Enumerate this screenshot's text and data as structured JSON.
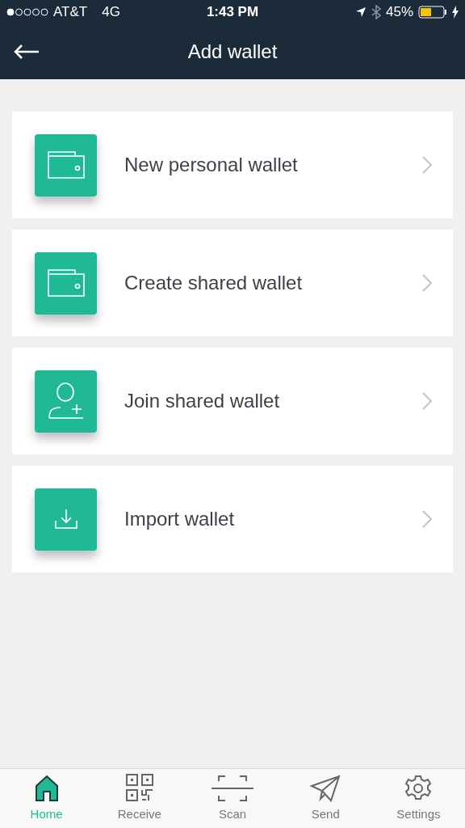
{
  "status_bar": {
    "carrier": "AT&T",
    "network": "4G",
    "time": "1:43 PM",
    "battery": "45%"
  },
  "header": {
    "title": "Add wallet"
  },
  "items": [
    {
      "kind": "wallet",
      "label": "New personal wallet"
    },
    {
      "kind": "wallet",
      "label": "Create shared wallet"
    },
    {
      "kind": "user-add",
      "label": "Join shared wallet"
    },
    {
      "kind": "import",
      "label": "Import wallet"
    }
  ],
  "tabs": [
    {
      "kind": "home",
      "label": "Home",
      "selected": true
    },
    {
      "kind": "qr",
      "label": "Receive",
      "selected": false
    },
    {
      "kind": "scan",
      "label": "Scan",
      "selected": false
    },
    {
      "kind": "send",
      "label": "Send",
      "selected": false
    },
    {
      "kind": "settings",
      "label": "Settings",
      "selected": false
    }
  ]
}
